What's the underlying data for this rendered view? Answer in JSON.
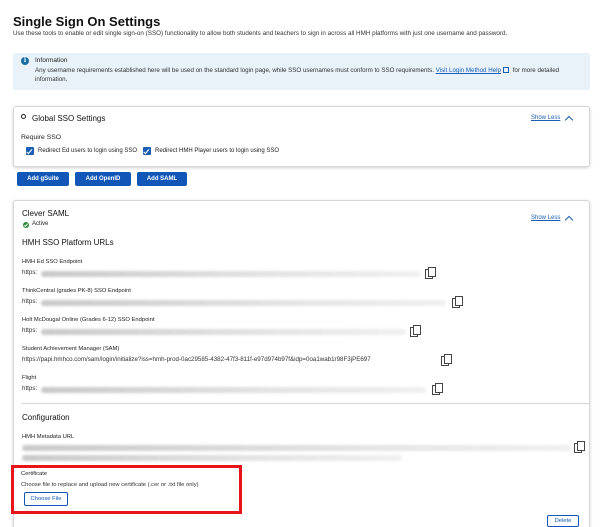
{
  "page": {
    "title": "Single Sign On Settings",
    "description": "Use these tools to enable or edit single sign-on (SSO) functionality to allow both students and teachers to sign in across all HMH platforms with just one username and password."
  },
  "info": {
    "icon": "info-icon",
    "title": "Information",
    "text": "Any username requirements established here will be used on the standard login page, while SSO usernames must conform to SSO requirements.",
    "link": "Visit Login Method Help",
    "text_after": "for more detailed information."
  },
  "global_sso": {
    "title": "Global SSO Settings",
    "show_less": "Show Less",
    "require_label": "Require SSO",
    "checkboxes": [
      {
        "label": "Redirect Ed users to login using SSO",
        "checked": true
      },
      {
        "label": "Redirect HMH Player users to login using SSO",
        "checked": true
      }
    ]
  },
  "add_buttons": [
    "Add gSuite",
    "Add OpenID",
    "Add SAML"
  ],
  "clever": {
    "title": "Clever  SAML",
    "status": "Active",
    "show_less": "Show Less",
    "urls_heading": "HMH SSO Platform URLs",
    "fields": [
      {
        "label": "HMH Ed SSO Endpoint",
        "value": "https:"
      },
      {
        "label": "ThinkCentral (grades PK-8) SSO Endpoint",
        "value": "https:"
      },
      {
        "label": "Holt McDougal Online (Grades 6-12) SSO Endpoint",
        "value": "https:"
      },
      {
        "label": "Student Achievement Manager (SAM)",
        "value": "https://papi.hmhco.com/sam/login/initialize?iss=hmh-prod-0ac29585-4382-47f3-811f-e97d974b97f&idp=0oa1wab1r98F3jPE697"
      },
      {
        "label": "Flight",
        "value": "https:"
      }
    ],
    "config_heading": "Configuration",
    "metadata_label": "HMH Metadata URL",
    "certificate_label": "Certificate",
    "certificate_desc": "Choose file to replace and upload new certificate (.cer or .txt file only)",
    "choose_file": "Choose File",
    "delete": "Delete"
  },
  "colors": {
    "accent": "#1257b8",
    "highlight": "#e8141c",
    "info_bg": "#e8f2f8",
    "active": "#2e8b3a"
  }
}
